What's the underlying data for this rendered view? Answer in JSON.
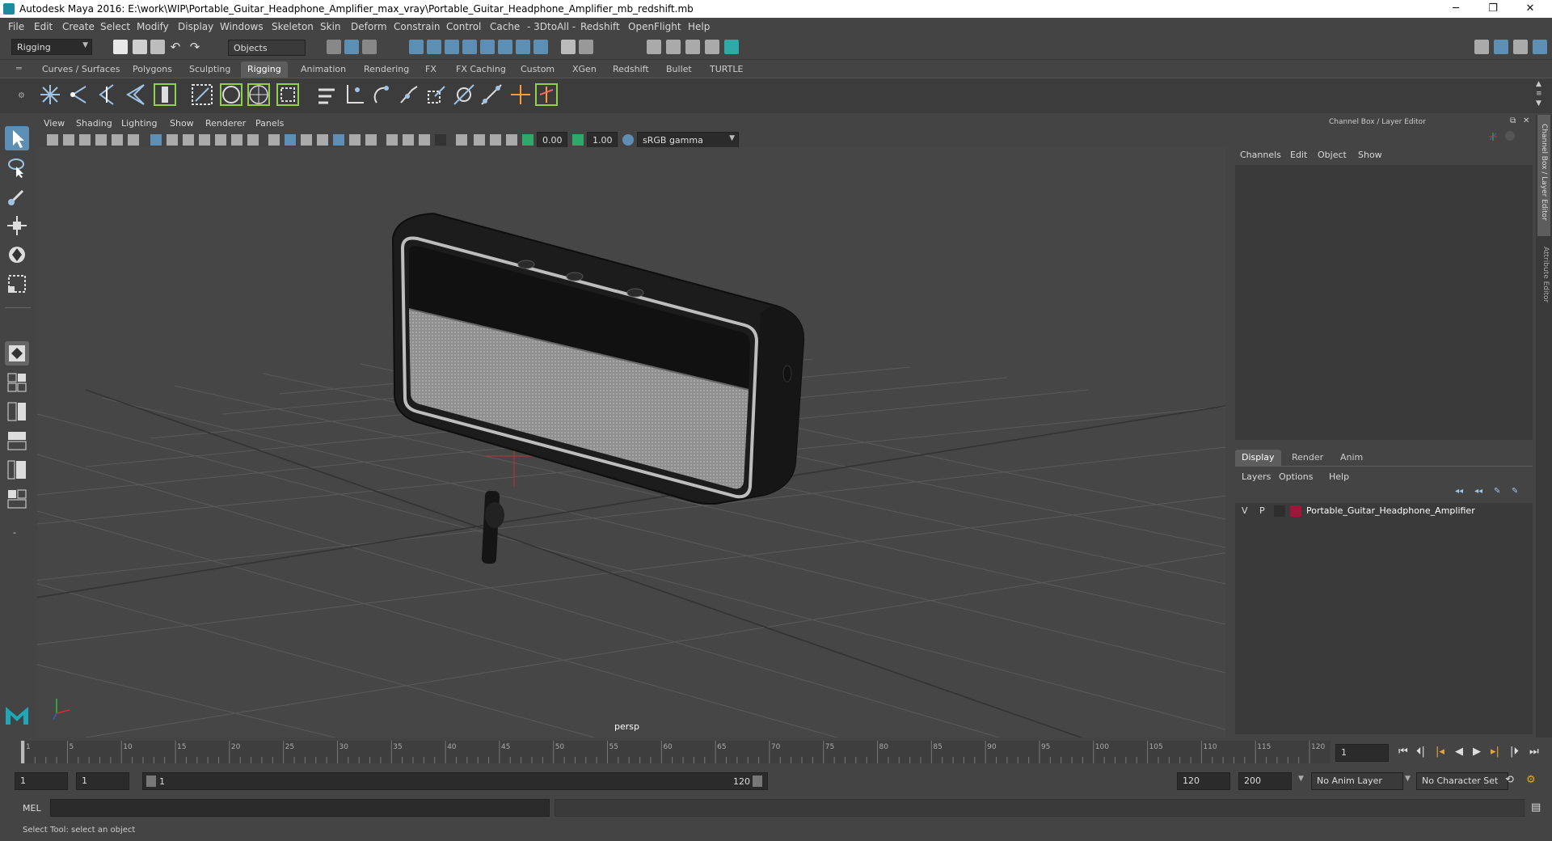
{
  "window": {
    "title": "Autodesk Maya 2016: E:\\work\\WIP\\Portable_Guitar_Headphone_Amplifier_max_vray\\Portable_Guitar_Headphone_Amplifier_mb_redshift.mb",
    "minimize": "─",
    "restore": "❐",
    "close": "✕"
  },
  "menubar": [
    "File",
    "Edit",
    "Create",
    "Select",
    "Modify",
    "Display",
    "Windows",
    "Skeleton",
    "Skin",
    "Deform",
    "Constrain",
    "Control",
    "Cache",
    "- 3DtoAll -",
    "Redshift",
    "OpenFlight",
    "Help"
  ],
  "statusline": {
    "mode": "Rigging",
    "selection_mode": "Objects"
  },
  "shelf_tabs": [
    "Curves / Surfaces",
    "Polygons",
    "Sculpting",
    "Rigging",
    "Animation",
    "Rendering",
    "FX",
    "FX Caching",
    "Custom",
    "XGen",
    "Redshift",
    "Bullet",
    "TURTLE"
  ],
  "active_shelf_tab": "Rigging",
  "viewport": {
    "menus": [
      "View",
      "Shading",
      "Lighting",
      "Show",
      "Renderer",
      "Panels"
    ],
    "exposure": "0.00",
    "gamma": "1.00",
    "color_space": "sRGB gamma",
    "camera_label": "persp"
  },
  "channel_box": {
    "title": "Channel Box / Layer Editor",
    "menus": [
      "Channels",
      "Edit",
      "Object",
      "Show"
    ]
  },
  "layer_editor": {
    "tabs": [
      "Display",
      "Render",
      "Anim"
    ],
    "active_tab": "Display",
    "menus": [
      "Layers",
      "Options",
      "Help"
    ],
    "layers": [
      {
        "visible": "V",
        "playback": "P",
        "name": "Portable_Guitar_Headphone_Amplifier",
        "color": "#a0163a"
      }
    ]
  },
  "side_tabs": [
    "Channel Box / Layer Editor",
    "Attribute Editor"
  ],
  "timeline": {
    "ticks": [
      "1",
      "5",
      "10",
      "15",
      "20",
      "25",
      "30",
      "35",
      "40",
      "45",
      "50",
      "55",
      "60",
      "65",
      "70",
      "75",
      "80",
      "85",
      "90",
      "95",
      "100",
      "105",
      "110",
      "115",
      "120"
    ],
    "current_frame": "1"
  },
  "range": {
    "start": "1",
    "playback_start": "1",
    "slider_start": "1",
    "slider_end": "120",
    "playback_end": "120",
    "end": "200",
    "anim_layer": "No Anim Layer",
    "character_set": "No Character Set"
  },
  "command_line": {
    "label": "MEL"
  },
  "help_line": {
    "text": "Select Tool: select an object"
  },
  "colors": {
    "accent": "#5d8fb5",
    "layer_color": "#a0163a",
    "axis_x": "#d03030",
    "axis_y": "#30c030",
    "axis_z": "#3060d0"
  }
}
